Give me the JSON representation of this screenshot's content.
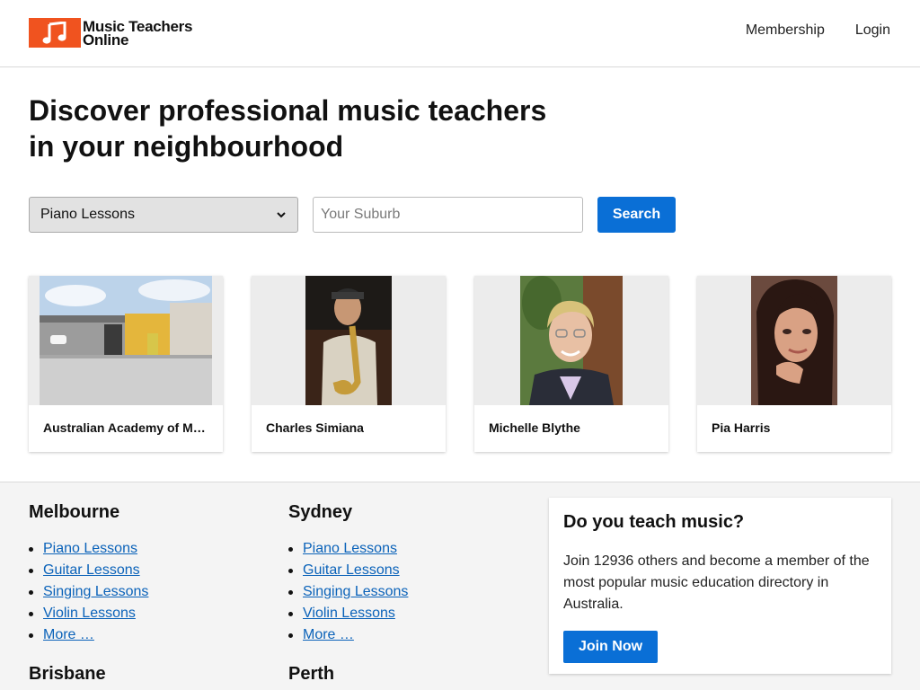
{
  "header": {
    "logo_line1": "Music Teachers",
    "logo_line2": "Online",
    "nav": [
      {
        "label": "Membership"
      },
      {
        "label": "Login"
      }
    ]
  },
  "hero": {
    "title_line1": "Discover professional music teachers",
    "title_line2": "in your neighbourhood"
  },
  "search": {
    "instrument_selected": "Piano Lessons",
    "suburb_placeholder": "Your Suburb",
    "button_label": "Search"
  },
  "cards": [
    {
      "name": "Australian Academy of Music"
    },
    {
      "name": "Charles Simiana"
    },
    {
      "name": "Michelle Blythe"
    },
    {
      "name": "Pia Harris"
    }
  ],
  "cities": [
    {
      "name": "Melbourne",
      "links": [
        "Piano Lessons",
        "Guitar Lessons",
        "Singing Lessons",
        "Violin Lessons",
        "More …"
      ]
    },
    {
      "name": "Sydney",
      "links": [
        "Piano Lessons",
        "Guitar Lessons",
        "Singing Lessons",
        "Violin Lessons",
        "More …"
      ]
    },
    {
      "name": "Brisbane"
    },
    {
      "name": "Perth"
    }
  ],
  "cta": {
    "title": "Do you teach music?",
    "body": "Join 12936 others and become a member of the most popular music education directory in Australia.",
    "button_label": "Join Now"
  },
  "colors": {
    "brand_orange": "#f0531f",
    "primary_blue": "#0a6fd6",
    "link_blue": "#0a62b9"
  }
}
